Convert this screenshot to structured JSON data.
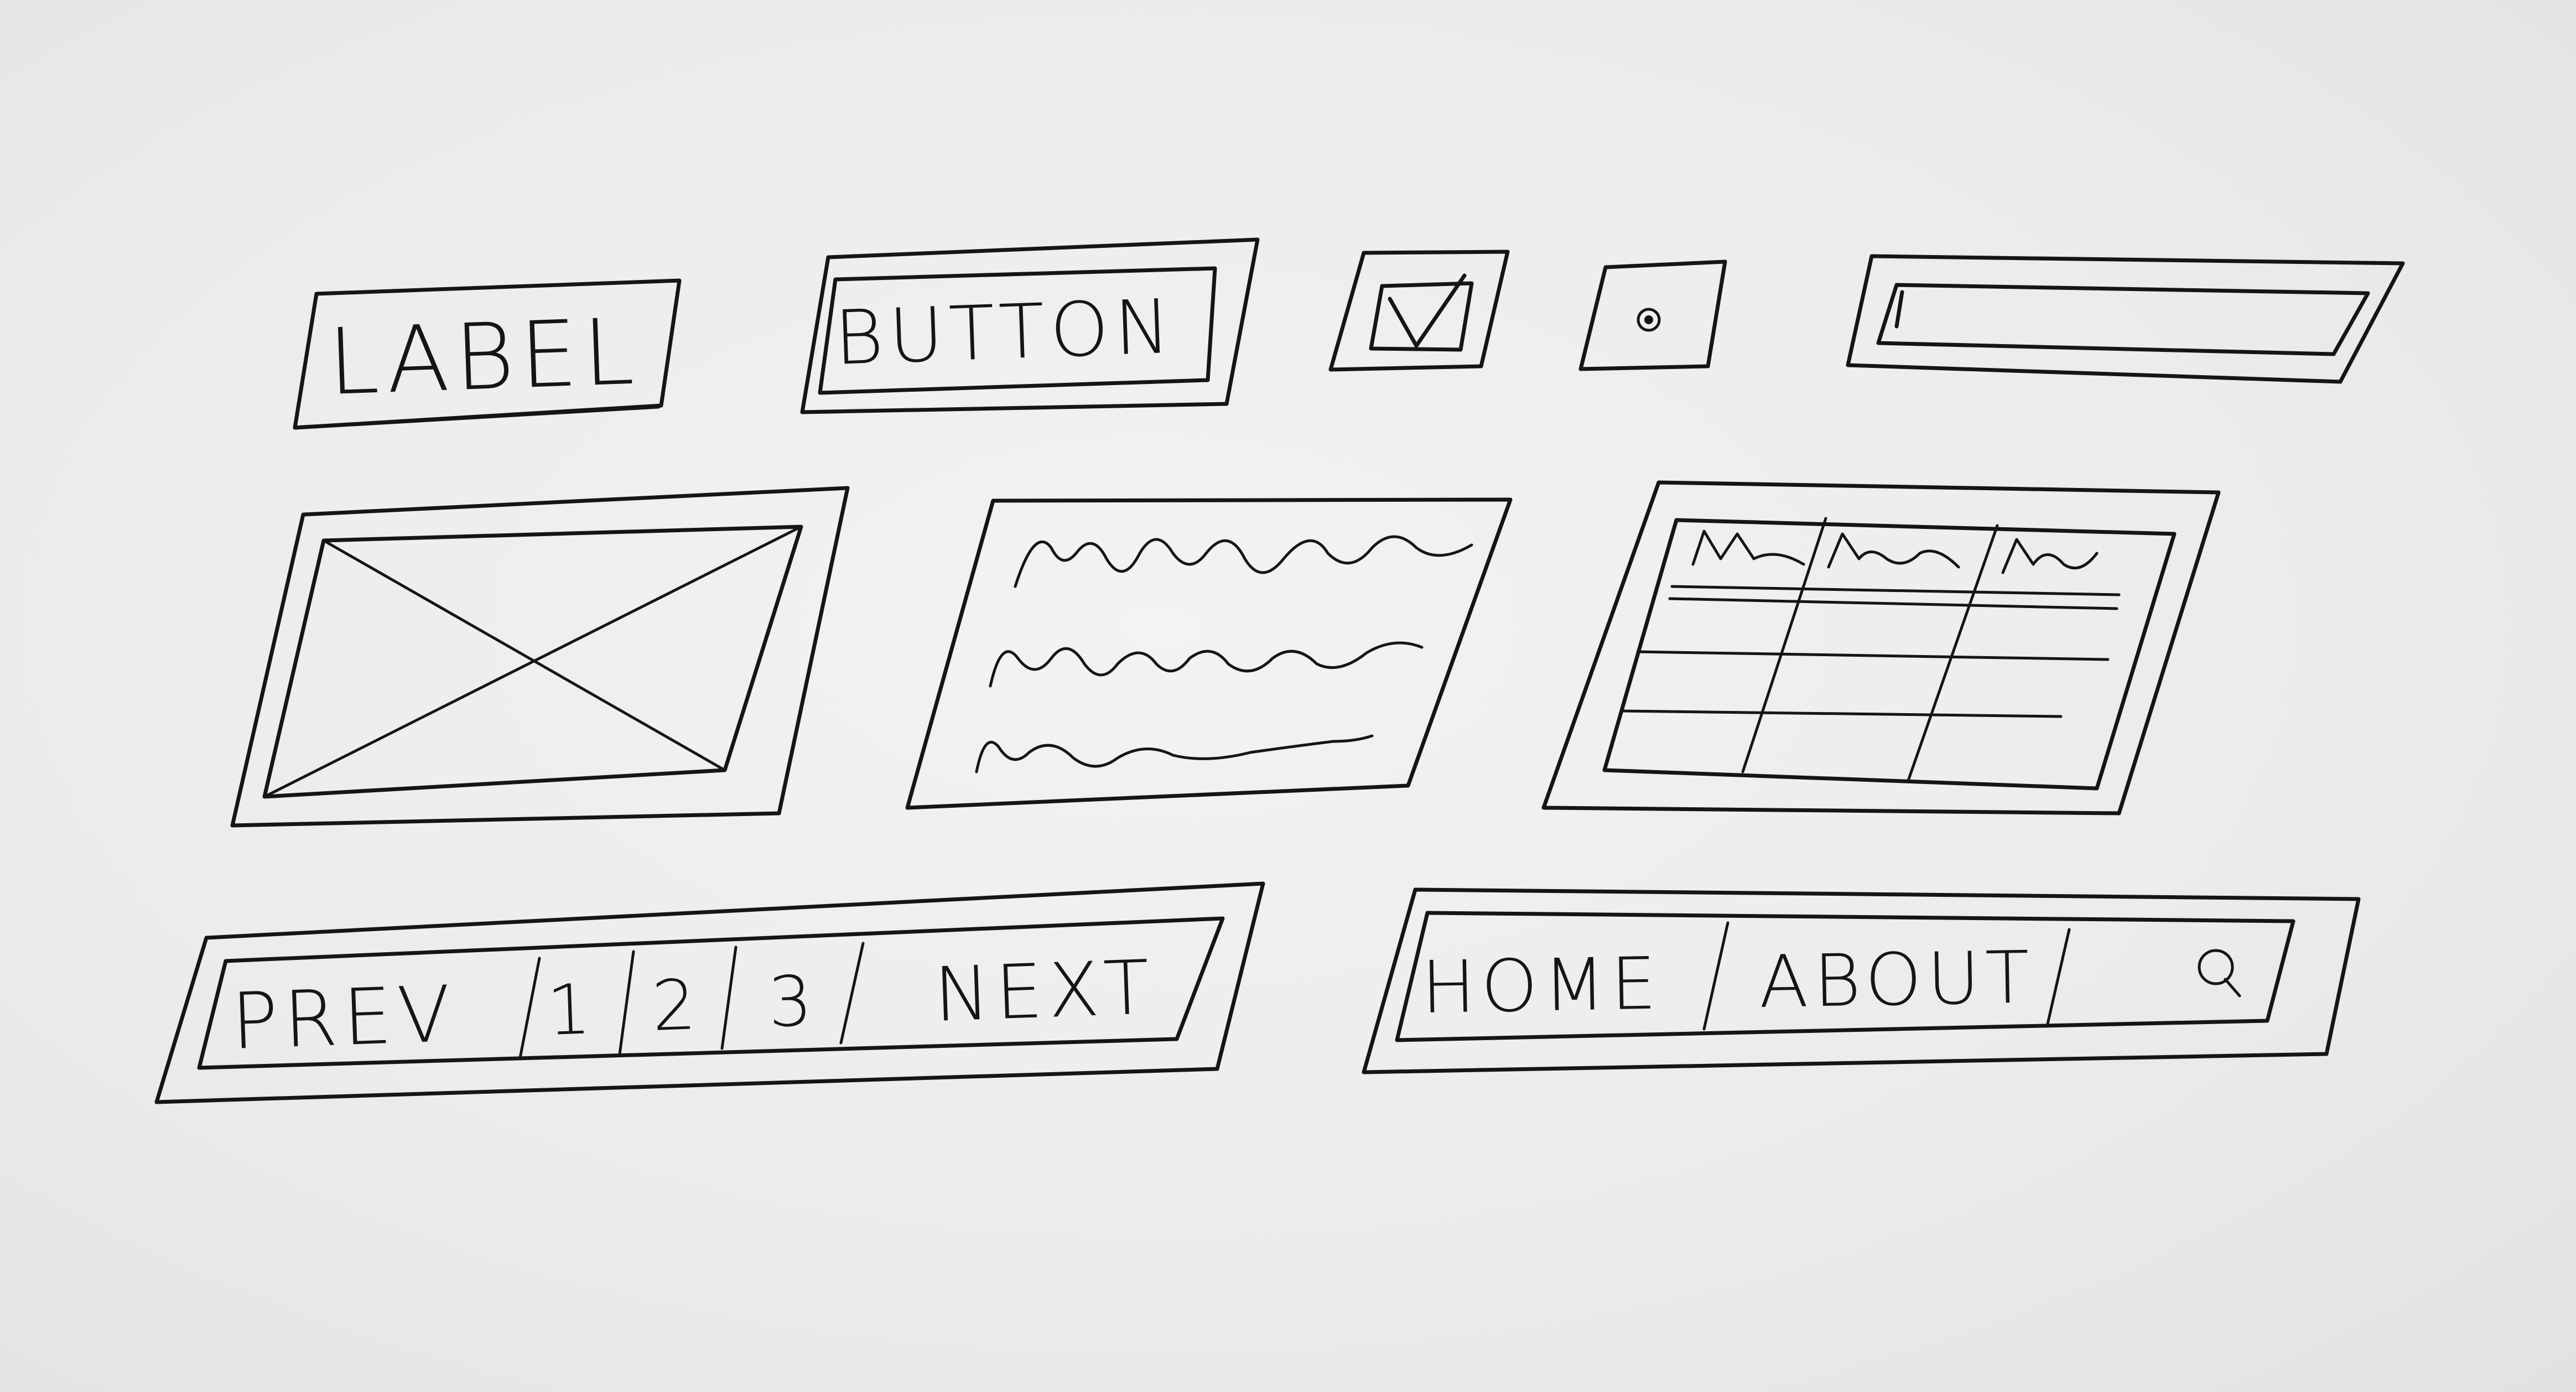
{
  "widgets": {
    "label": {
      "text": "LABEL"
    },
    "button": {
      "text": "BUTTON"
    },
    "checkbox": {
      "checked": true
    },
    "radio": {
      "selected": true
    }
  },
  "pagination": {
    "prev": "PREV",
    "pages": [
      "1",
      "2",
      "3"
    ],
    "next": "NEXT"
  },
  "navbar": {
    "items": [
      "HOME",
      "ABOUT"
    ],
    "search_icon": "search-icon"
  },
  "ink_color": "#151515"
}
